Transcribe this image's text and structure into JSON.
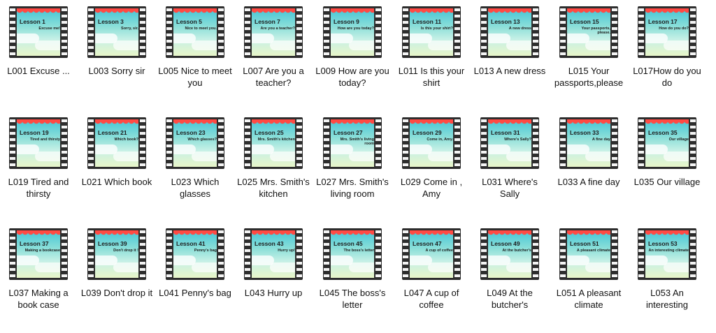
{
  "rows": [
    {
      "items": [
        {
          "lesson": "Lesson 1",
          "subtitle": "Excuse me!",
          "label": "L001 Excuse ..."
        },
        {
          "lesson": "Lesson 3",
          "subtitle": "Sorry, sir.",
          "label": "L003 Sorry sir"
        },
        {
          "lesson": "Lesson 5",
          "subtitle": "Nice to meet you.",
          "label": "L005 Nice to meet you"
        },
        {
          "lesson": "Lesson 7",
          "subtitle": "Are you a teacher?",
          "label": "L007 Are you a teacher?"
        },
        {
          "lesson": "Lesson 9",
          "subtitle": "How are you today?",
          "label": "L009 How are you today?"
        },
        {
          "lesson": "Lesson 11",
          "subtitle": "Is this your shirt?",
          "label": "L011 Is this your shirt"
        },
        {
          "lesson": "Lesson 13",
          "subtitle": "A new dress",
          "label": "L013 A new dress"
        },
        {
          "lesson": "Lesson 15",
          "subtitle": "Your passports, please.",
          "label": "L015 Your passports,please"
        },
        {
          "lesson": "Lesson 17",
          "subtitle": "How do you do?",
          "label": "L017How do you do"
        }
      ]
    },
    {
      "items": [
        {
          "lesson": "Lesson 19",
          "subtitle": "Tired and thirsty",
          "label": "L019 Tired and thirsty"
        },
        {
          "lesson": "Lesson 21",
          "subtitle": "Which book?",
          "label": "L021 Which book"
        },
        {
          "lesson": "Lesson 23",
          "subtitle": "Which glasses?",
          "label": "L023 Which glasses"
        },
        {
          "lesson": "Lesson 25",
          "subtitle": "Mrs. Smith's kitchen",
          "label": "L025 Mrs. Smith's kitchen"
        },
        {
          "lesson": "Lesson 27",
          "subtitle": "Mrs. Smith's living room",
          "label": "L027 Mrs. Smith's living room"
        },
        {
          "lesson": "Lesson 29",
          "subtitle": "Come in, Amy.",
          "label": "L029 Come in , Amy"
        },
        {
          "lesson": "Lesson 31",
          "subtitle": "Where's Sally?",
          "label": "L031 Where's Sally"
        },
        {
          "lesson": "Lesson 33",
          "subtitle": "A fine day",
          "label": "L033 A fine day"
        },
        {
          "lesson": "Lesson 35",
          "subtitle": "Our village",
          "label": "L035 Our village"
        }
      ]
    },
    {
      "items": [
        {
          "lesson": "Lesson 37",
          "subtitle": "Making a bookcase",
          "label": "L037 Making a book case"
        },
        {
          "lesson": "Lesson 39",
          "subtitle": "Don't drop it !",
          "label": "L039 Don't drop it"
        },
        {
          "lesson": "Lesson 41",
          "subtitle": "Penny's bag",
          "label": "L041 Penny's bag"
        },
        {
          "lesson": "Lesson 43",
          "subtitle": "Hurry up!",
          "label": "L043 Hurry up"
        },
        {
          "lesson": "Lesson 45",
          "subtitle": "The boss's letter",
          "label": "L045 The boss's letter"
        },
        {
          "lesson": "Lesson 47",
          "subtitle": "A cup of coffee",
          "label": "L047 A cup of coffee"
        },
        {
          "lesson": "Lesson 49",
          "subtitle": "At the butcher's",
          "label": "L049 At the butcher's"
        },
        {
          "lesson": "Lesson 51",
          "subtitle": "A pleasant climate",
          "label": "L051 A pleasant climate"
        },
        {
          "lesson": "Lesson 53",
          "subtitle": "An interesting climate",
          "label": "L053 An interesting"
        }
      ]
    }
  ]
}
